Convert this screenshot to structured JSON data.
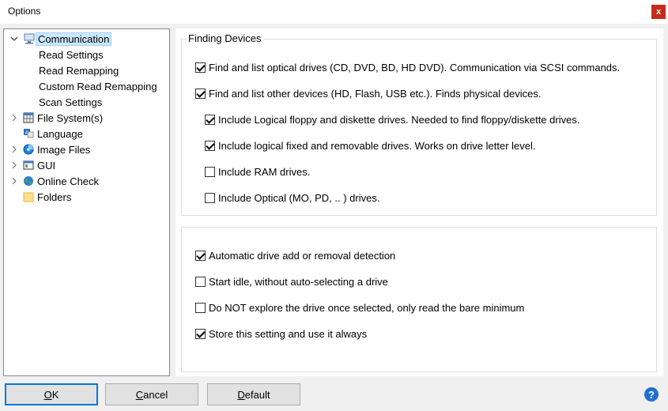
{
  "window": {
    "title": "Options",
    "close_label": "x"
  },
  "tree": {
    "items": [
      {
        "label": "Communication",
        "icon": "computer-network-icon",
        "expanded": true,
        "selected": true
      },
      {
        "label": "Read Settings"
      },
      {
        "label": "Read Remapping"
      },
      {
        "label": "Custom Read Remapping"
      },
      {
        "label": "Scan Settings"
      },
      {
        "label": "File System(s)",
        "icon": "file-system-grid-icon"
      },
      {
        "label": "Language",
        "icon": "language-icon"
      },
      {
        "label": "Image Files",
        "icon": "disc-image-icon"
      },
      {
        "label": "GUI",
        "icon": "window-gui-icon"
      },
      {
        "label": "Online Check",
        "icon": "globe-icon"
      },
      {
        "label": "Folders",
        "icon": "folder-icon"
      }
    ]
  },
  "finding_devices": {
    "title": "Finding Devices",
    "options": [
      {
        "label": "Find and list optical drives (CD, DVD, BD, HD DVD).  Communication via SCSI commands.",
        "checked": true
      },
      {
        "label": "Find and list other devices (HD, Flash, USB etc.).  Finds physical devices.",
        "checked": true
      },
      {
        "label": "Include Logical floppy and diskette drives.  Needed to find floppy/diskette drives.",
        "checked": true
      },
      {
        "label": "Include logical fixed and removable drives.  Works on drive letter level.",
        "checked": true
      },
      {
        "label": "Include RAM drives.",
        "checked": false
      },
      {
        "label": "Include Optical (MO, PD, .. ) drives.",
        "checked": false
      }
    ]
  },
  "detection": {
    "options": [
      {
        "label": "Automatic drive add or removal detection",
        "checked": true
      },
      {
        "label": "Start idle, without auto-selecting a drive",
        "checked": false
      },
      {
        "label": "Do NOT explore the drive once selected, only read the bare minimum",
        "checked": false
      },
      {
        "label": "Store this setting and use it always",
        "checked": true
      }
    ]
  },
  "buttons": {
    "ok": {
      "underlined": "O",
      "rest": "K"
    },
    "cancel": {
      "underlined": "C",
      "rest": "ancel"
    },
    "default": {
      "underlined": "D",
      "rest": "efault"
    },
    "help": "?"
  }
}
